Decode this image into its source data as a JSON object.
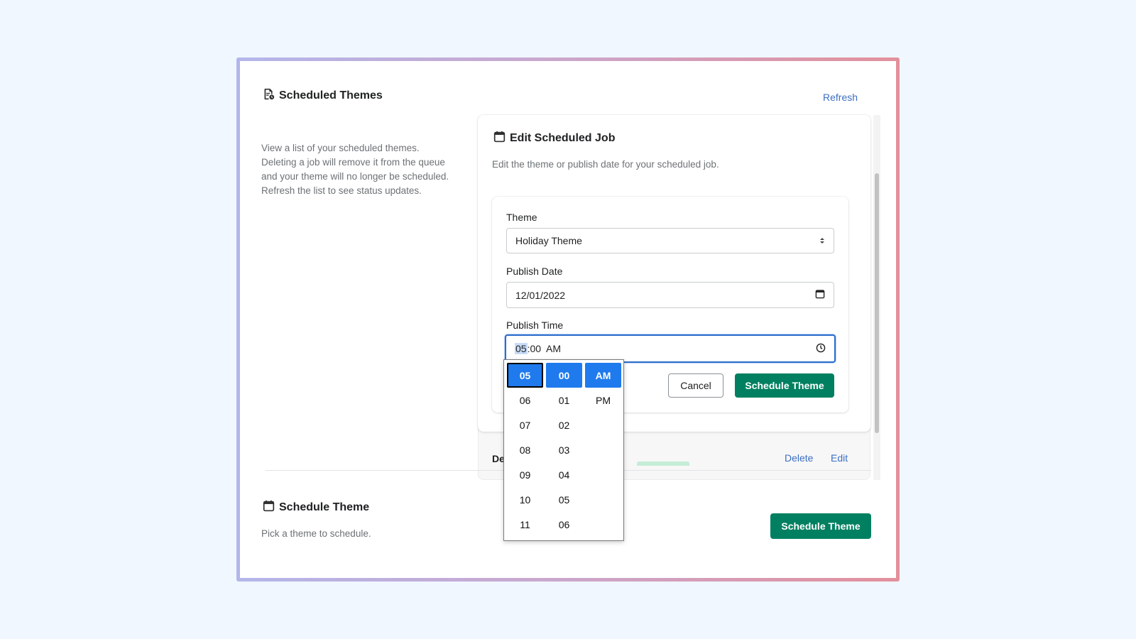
{
  "header": {
    "title": "Scheduled Themes",
    "refresh_label": "Refresh",
    "description": "View a list of your scheduled themes. Deleting a job will remove it from the queue and your theme will no longer be scheduled. Refresh the list to see status updates."
  },
  "edit_job": {
    "title": "Edit Scheduled Job",
    "description": "Edit the theme or publish date for your scheduled job.",
    "theme_label": "Theme",
    "theme_value": "Holiday Theme",
    "date_label": "Publish Date",
    "date_value": "12/01/2022",
    "time_label": "Publish Time",
    "time_hour": "05",
    "time_rest": ":00  AM",
    "cancel_label": "Cancel",
    "submit_label": "Schedule Theme"
  },
  "job_row": {
    "name_partial": "Def",
    "delete_label": "Delete",
    "edit_label": "Edit"
  },
  "time_picker": {
    "hours": [
      "05",
      "06",
      "07",
      "08",
      "09",
      "10",
      "11"
    ],
    "minutes": [
      "00",
      "01",
      "02",
      "03",
      "04",
      "05",
      "06"
    ],
    "periods": [
      "AM",
      "PM"
    ],
    "selected": {
      "hour": "05",
      "minute": "00",
      "period": "AM"
    }
  },
  "schedule_section": {
    "title": "Schedule Theme",
    "description": "Pick a theme to schedule.",
    "button_label": "Schedule Theme"
  },
  "colors": {
    "accent_green": "#008060",
    "link_blue": "#3b6fc2",
    "picker_selected": "#1f7aed"
  }
}
